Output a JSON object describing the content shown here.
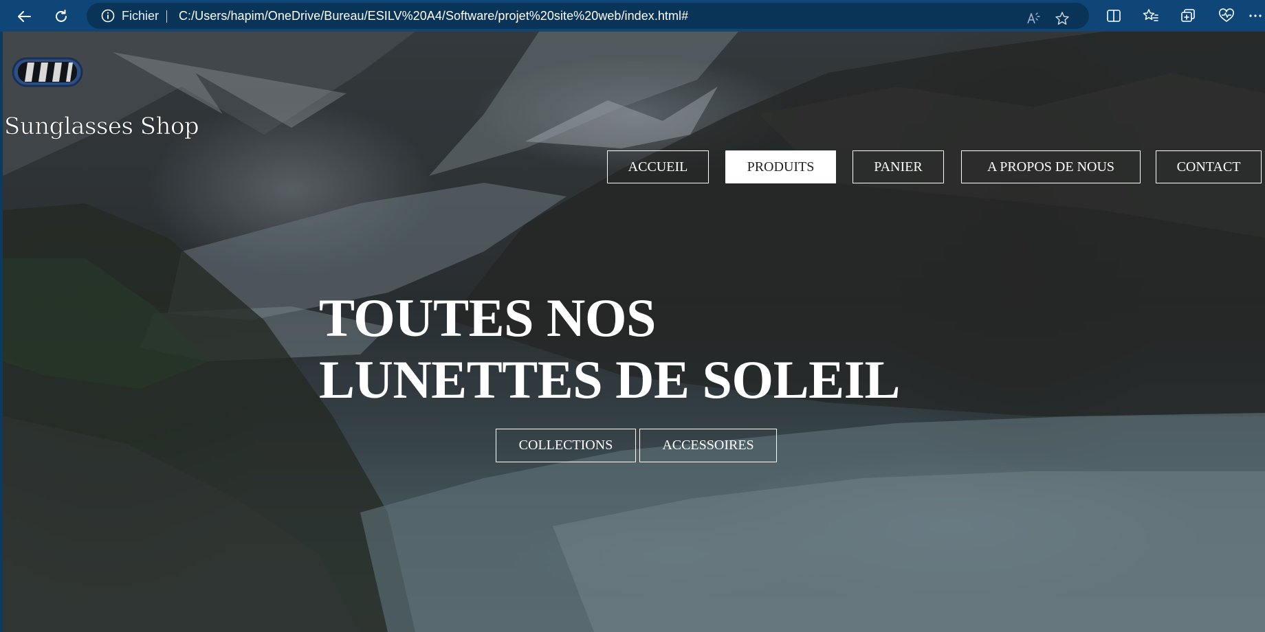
{
  "browser": {
    "address": {
      "scheme_label": "Fichier",
      "url": "C:/Users/hapim/OneDrive/Bureau/ESILV%20A4/Software/projet%20site%20web/index.html#"
    },
    "icons": [
      "back-icon",
      "refresh-icon",
      "info-icon",
      "read-aloud-icon",
      "favorite-star-icon",
      "split-screen-icon",
      "favorites-icon",
      "collections-icon",
      "browser-essentials-icon",
      "more-icon"
    ],
    "colors": {
      "toolbar": "#0d4677",
      "address_bar": "#0a3358"
    }
  },
  "page": {
    "brand_name": "Sunglasses Shop",
    "logo": "ski-goggles-logo",
    "nav": [
      {
        "label": "ACCUEIL",
        "active": false
      },
      {
        "label": "PRODUITS",
        "active": true
      },
      {
        "label": "PANIER",
        "active": false
      },
      {
        "label": "A PROPOS DE NOUS",
        "active": false
      },
      {
        "label": "CONTACT",
        "active": false
      }
    ],
    "hero": {
      "title_line1": "TOUTES NOS",
      "title_line2": "LUNETTES DE SOLEIL",
      "buttons": [
        "COLLECTIONS",
        "ACCESSOIRES"
      ]
    },
    "background": "glacier-mountain-photo",
    "colors": {
      "text": "#ffffff",
      "active_nav_bg": "#ffffff",
      "active_nav_text": "#222222"
    }
  }
}
